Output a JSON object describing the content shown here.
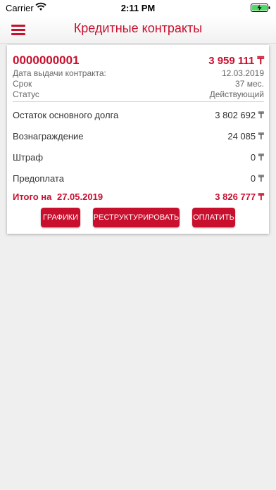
{
  "status_bar": {
    "carrier": "Carrier",
    "time": "2:11 PM"
  },
  "header": {
    "title": "Кредитные контракты",
    "menu_icon": "hamburger-menu-icon"
  },
  "contract": {
    "number": "0000000001",
    "total_amount": "3 959 111 ₸",
    "details": [
      {
        "label": "Дата выдачи контракта:",
        "value": "12.03.2019"
      },
      {
        "label": "Срок",
        "value": "37 мес."
      },
      {
        "label": "Статус",
        "value": "Действующий"
      }
    ],
    "breakdown": [
      {
        "label": "Остаток основного долга",
        "value": "3 802 692 ₸"
      },
      {
        "label": "Вознаграждение",
        "value": "24 085 ₸"
      },
      {
        "label": "Штраф",
        "value": "0 ₸"
      },
      {
        "label": "Предоплата",
        "value": "0 ₸"
      }
    ],
    "total": {
      "label": "Итого на",
      "date": "27.05.2019",
      "value": "3 826 777 ₸"
    }
  },
  "buttons": {
    "schedules": "ГРАФИКИ",
    "restructure": "РЕСТРУКТУРИРОВАТЬ",
    "pay": "ОПЛАТИТЬ"
  },
  "colors": {
    "accent": "#c8102e",
    "background": "#efefef"
  }
}
